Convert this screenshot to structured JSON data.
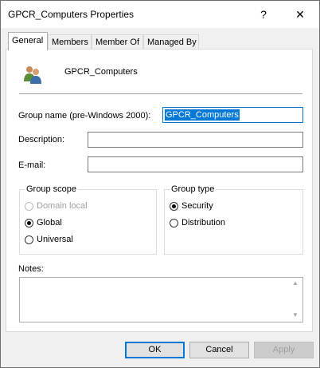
{
  "window": {
    "title": "GPCR_Computers Properties",
    "help_glyph": "?",
    "close_glyph": "✕"
  },
  "tabs": [
    {
      "label": "General",
      "active": true
    },
    {
      "label": "Members",
      "active": false
    },
    {
      "label": "Member Of",
      "active": false
    },
    {
      "label": "Managed By",
      "active": false
    }
  ],
  "general": {
    "group_icon": "group-users-icon",
    "group_name_display": "GPCR_Computers",
    "pre2000_label": "Group name (pre-Windows 2000):",
    "pre2000_value": "GPCR_Computers",
    "description_label": "Description:",
    "description_value": "",
    "email_label": "E-mail:",
    "email_value": "",
    "group_scope": {
      "title": "Group scope",
      "options": [
        "Domain local",
        "Global",
        "Universal"
      ],
      "selected": "Global",
      "disabled": [
        "Domain local"
      ]
    },
    "group_type": {
      "title": "Group type",
      "options": [
        "Security",
        "Distribution"
      ],
      "selected": "Security"
    },
    "notes_label": "Notes:",
    "notes_value": ""
  },
  "buttons": {
    "ok": "OK",
    "cancel": "Cancel",
    "apply": "Apply"
  },
  "colors": {
    "accent": "#0078d7",
    "dialog_bg": "#f0f0f0"
  }
}
